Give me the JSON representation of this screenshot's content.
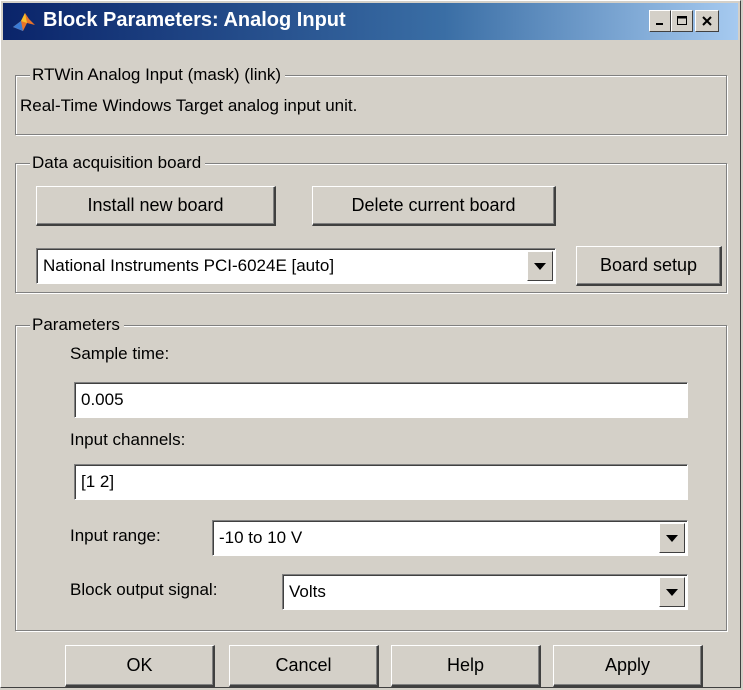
{
  "window": {
    "title": "Block Parameters: Analog Input",
    "icon": "matlab-icon"
  },
  "description_group": {
    "legend": "RTWin Analog Input (mask) (link)",
    "text": "Real-Time Windows Target analog input unit."
  },
  "board_group": {
    "legend": "Data acquisition board",
    "install_label": "Install new board",
    "delete_label": "Delete current board",
    "board_select_value": "National Instruments PCI-6024E [auto]",
    "board_setup_label": "Board setup"
  },
  "parameters_group": {
    "legend": "Parameters",
    "sample_time_label": "Sample time:",
    "sample_time_value": "0.005",
    "input_channels_label": "Input channels:",
    "input_channels_value": "[1 2]",
    "input_range_label": "Input range:",
    "input_range_value": "-10 to 10 V",
    "output_signal_label": "Block output signal:",
    "output_signal_value": "Volts"
  },
  "buttons": {
    "ok": "OK",
    "cancel": "Cancel",
    "help": "Help",
    "apply": "Apply"
  }
}
